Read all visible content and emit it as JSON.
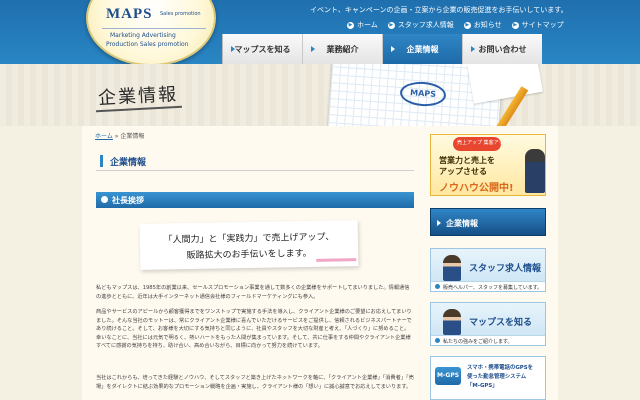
{
  "header": {
    "logo": {
      "title": "MAPS",
      "sub": "Sales promotion",
      "tagline_1": "Marketing Advertising",
      "tagline_2": "Production Sales promotion"
    },
    "tagline": "イベント、キャンペーンの企画・立案から企業の販売促進をお手伝いしています。",
    "utility": [
      {
        "label": "ホーム",
        "icon": "home-icon"
      },
      {
        "label": "スタッフ求人情報",
        "icon": "person-icon"
      },
      {
        "label": "お知らせ",
        "icon": "info-icon"
      },
      {
        "label": "サイトマップ",
        "icon": "sitemap-icon"
      }
    ],
    "nav": [
      {
        "label": "マップスを知る",
        "active": false
      },
      {
        "label": "業務紹介",
        "active": false
      },
      {
        "label": "企業情報",
        "active": true
      },
      {
        "label": "お問い合わせ",
        "active": false
      }
    ]
  },
  "hero": {
    "title": "企業情報",
    "paper_label": "MAPS"
  },
  "breadcrumb": {
    "home": "ホーム",
    "separator": " » ",
    "current": "企業情報"
  },
  "main": {
    "heading": "企業情報",
    "section_title": "社長挨拶",
    "quote": {
      "line1": "「人間力」と「実践力」で売上げアップ、",
      "line2": "販路拡大のお手伝いをします。"
    },
    "paragraphs": [
      "私どもマップスは、1985年の創業以来、セールスプロモーション事業を通して数多くの企業様をサポートしてまいりました。情報通信の進歩とともに、近年は大手インターネット通信会社様のフィールドマーケティングにも参入。",
      "商品やサービスのアピールから顧客獲得までをワンストップで実施する手法を導入し、クライアント企業様のご要望にお応えしてまいりました。そんな当社のモットーは、常にクライアント企業様に喜んでいただけるサービスをご提供し、信頼されるビジネスパートナーであり続けること。そして、お客様を大切にする気持ちと同じように、社員やスタッフを大切な財産と考え、「人づくり」に努めること。幸いなことに、当社には元気で明るく、熱いハートをもった人間が集まっています。そして、共に仕事をする仲間やクライアント企業様すべてに感謝の気持ちを持ち、助け合い、高め合いながら、目標に向かって努力を続けています。",
      "当社はこれからも、培ってきた経験とノウハウ、そしてスタッフと築き上げたネットワークを軸に、「クライアント企業様」「消費者」「売場」をダイレクトに結ぶ効果的なプロモーション戦略を企画・実施し、クライアント様の「想い」に誠心誠意でお応えしてまいります。"
    ]
  },
  "sidebar": {
    "promo": {
      "badge": "売上アップ 集客アップ",
      "line1": "営業力と売上を",
      "line2": "アップさせる",
      "line3": "ノウハウ公開中!"
    },
    "active_item": "企業情報",
    "cards": [
      {
        "title": "スタッフ求人情報",
        "desc": "販売ヘルパー、スタッフを募集しています。"
      },
      {
        "title": "マップスを知る",
        "desc": "私たちの強みをご紹介します。"
      }
    ],
    "gps": {
      "logo": "M-GPS",
      "line1": "スマホ・携帯電話のGPSを",
      "line2": "使った勤怠管理システム",
      "line3": "「M-GPS」"
    }
  },
  "colors": {
    "header_blue": "#2a86c4",
    "accent_orange": "#d8681a",
    "heading_blue": "#1e4e8c"
  }
}
